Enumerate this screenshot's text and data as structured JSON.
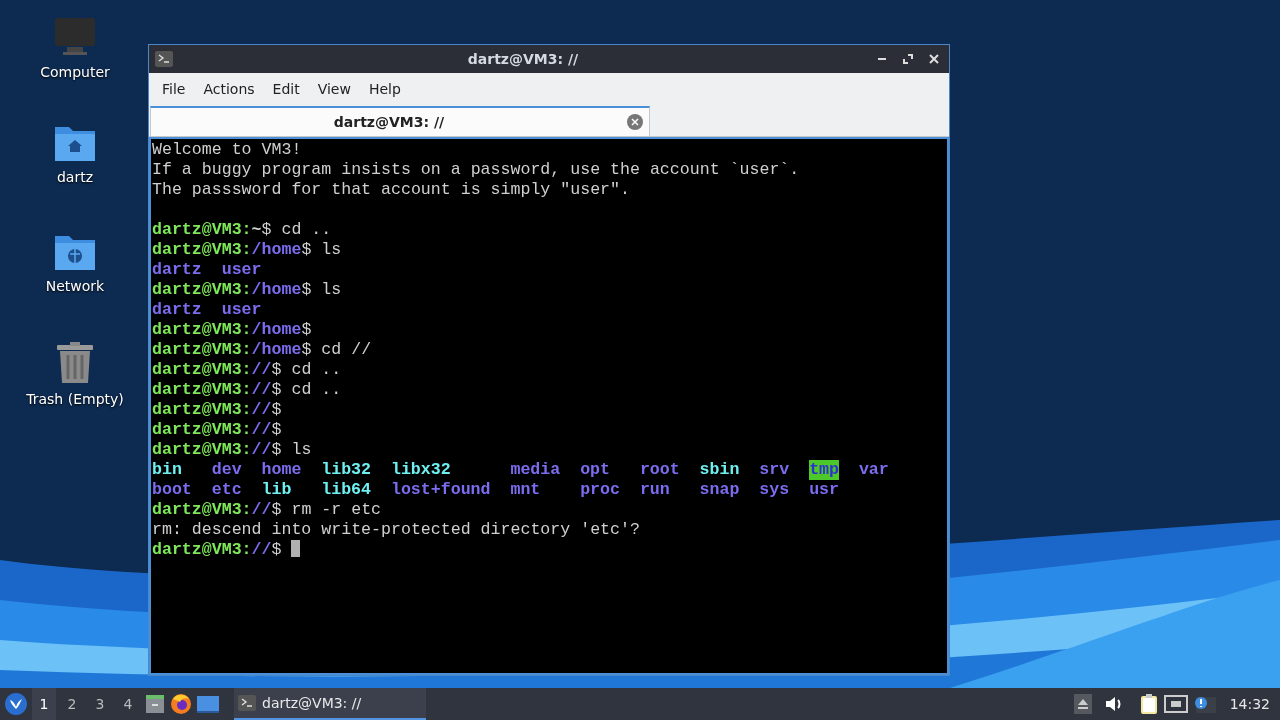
{
  "desktop": {
    "icons": [
      {
        "label": "Computer",
        "kind": "computer"
      },
      {
        "label": "dartz",
        "kind": "home"
      },
      {
        "label": "Network",
        "kind": "network"
      },
      {
        "label": "Trash (Empty)",
        "kind": "trash"
      }
    ]
  },
  "window": {
    "title": "dartz@VM3: //",
    "menu": [
      "File",
      "Actions",
      "Edit",
      "View",
      "Help"
    ],
    "tabs": [
      {
        "label": "dartz@VM3: //",
        "selected": true
      }
    ],
    "terminal": {
      "lines": [
        {
          "kind": "text",
          "text": "Welcome to VM3!"
        },
        {
          "kind": "text",
          "text": "If a buggy program insists on a password, use the account `user`."
        },
        {
          "kind": "text",
          "text": "The passsword for that account is simply \"user\"."
        },
        {
          "kind": "blank"
        },
        {
          "kind": "prompt",
          "host": "dartz@VM3:",
          "path": "~",
          "tail": "$ cd .."
        },
        {
          "kind": "prompt",
          "host": "dartz@VM3:",
          "path": "/home",
          "tail": "$ ls"
        },
        {
          "kind": "listing",
          "columns": [
            [
              {
                "name": "dartz",
                "kind": "dir"
              }
            ],
            [
              {
                "name": "user",
                "kind": "dir"
              }
            ]
          ]
        },
        {
          "kind": "prompt",
          "host": "dartz@VM3:",
          "path": "/home",
          "tail": "$ ls"
        },
        {
          "kind": "listing",
          "columns": [
            [
              {
                "name": "dartz",
                "kind": "dir"
              }
            ],
            [
              {
                "name": "user",
                "kind": "dir"
              }
            ]
          ]
        },
        {
          "kind": "prompt",
          "host": "dartz@VM3:",
          "path": "/home",
          "tail": "$"
        },
        {
          "kind": "prompt",
          "host": "dartz@VM3:",
          "path": "/home",
          "tail": "$ cd //"
        },
        {
          "kind": "prompt",
          "host": "dartz@VM3:",
          "path": "//",
          "tail": "$ cd .."
        },
        {
          "kind": "prompt",
          "host": "dartz@VM3:",
          "path": "//",
          "tail": "$ cd .."
        },
        {
          "kind": "prompt",
          "host": "dartz@VM3:",
          "path": "//",
          "tail": "$"
        },
        {
          "kind": "prompt",
          "host": "dartz@VM3:",
          "path": "//",
          "tail": "$"
        },
        {
          "kind": "prompt",
          "host": "dartz@VM3:",
          "path": "//",
          "tail": "$ ls"
        },
        {
          "kind": "listing",
          "columns": [
            [
              {
                "name": "bin",
                "kind": "link"
              },
              {
                "name": "boot",
                "kind": "dir"
              }
            ],
            [
              {
                "name": "dev",
                "kind": "dir"
              },
              {
                "name": "etc",
                "kind": "dir"
              }
            ],
            [
              {
                "name": "home",
                "kind": "dir"
              },
              {
                "name": "lib",
                "kind": "link"
              }
            ],
            [
              {
                "name": "lib32",
                "kind": "link"
              },
              {
                "name": "lib64",
                "kind": "link"
              }
            ],
            [
              {
                "name": "libx32",
                "kind": "link"
              },
              {
                "name": "lost+found",
                "kind": "dir"
              }
            ],
            [
              {
                "name": "media",
                "kind": "dir"
              },
              {
                "name": "mnt",
                "kind": "dir"
              }
            ],
            [
              {
                "name": "opt",
                "kind": "dir"
              },
              {
                "name": "proc",
                "kind": "dir"
              }
            ],
            [
              {
                "name": "root",
                "kind": "dir"
              },
              {
                "name": "run",
                "kind": "dir"
              }
            ],
            [
              {
                "name": "sbin",
                "kind": "link"
              },
              {
                "name": "snap",
                "kind": "dir"
              }
            ],
            [
              {
                "name": "srv",
                "kind": "dir"
              },
              {
                "name": "sys",
                "kind": "dir"
              }
            ],
            [
              {
                "name": "tmp",
                "kind": "sticky"
              },
              {
                "name": "usr",
                "kind": "dir"
              }
            ],
            [
              {
                "name": "var",
                "kind": "dir"
              }
            ]
          ]
        },
        {
          "kind": "prompt",
          "host": "dartz@VM3:",
          "path": "//",
          "tail": "$ rm -r etc"
        },
        {
          "kind": "text",
          "text": "rm: descend into write-protected directory 'etc'?"
        },
        {
          "kind": "prompt",
          "host": "dartz@VM3:",
          "path": "//",
          "tail": "$ ",
          "cursor": true
        }
      ]
    }
  },
  "taskbar": {
    "workspaces": [
      {
        "label": "1",
        "selected": true
      },
      {
        "label": "2",
        "selected": false
      },
      {
        "label": "3",
        "selected": false
      },
      {
        "label": "4",
        "selected": false
      }
    ],
    "tasks": [
      {
        "label": "dartz@VM3: //",
        "selected": true
      }
    ],
    "clock": "14:32"
  }
}
